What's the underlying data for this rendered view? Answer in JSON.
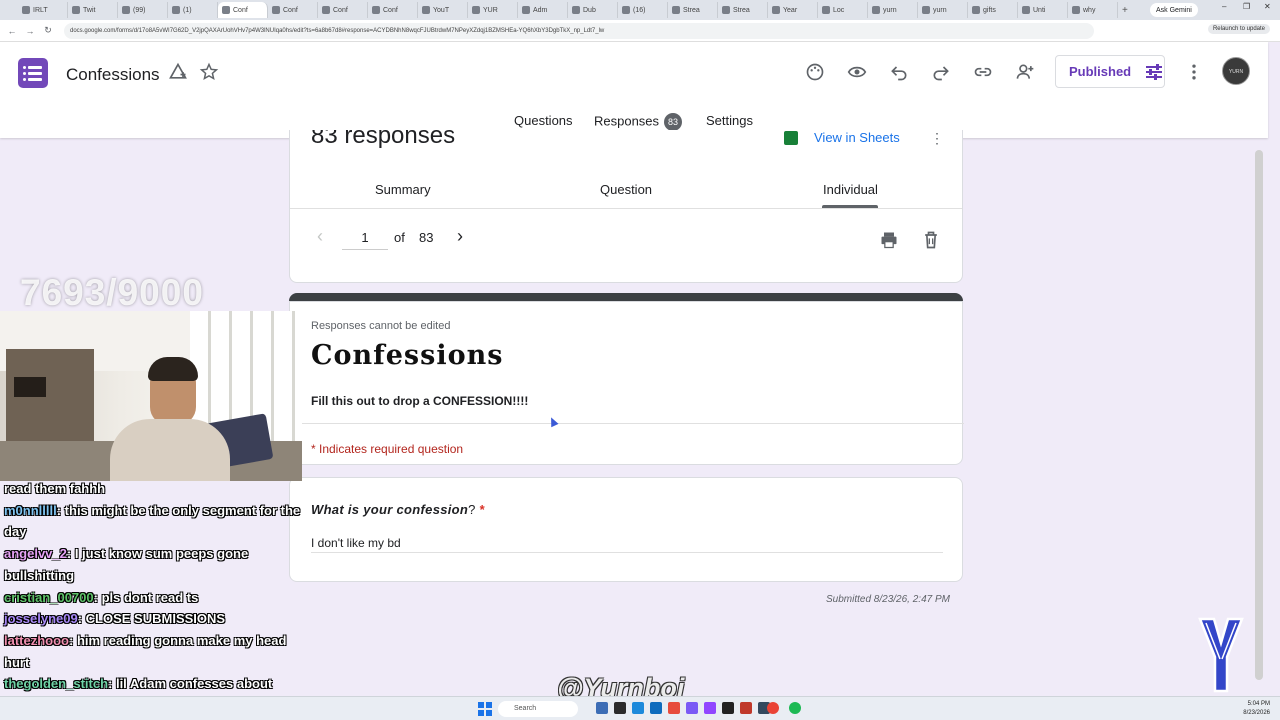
{
  "browser": {
    "tabs": [
      "IRLT",
      "Twit",
      "(99)",
      "(1)",
      "Conf",
      "Conf",
      "Conf",
      "Conf",
      "YouT",
      "YUR",
      "Adm",
      "Dub",
      "(16)",
      "Strea",
      "Strea",
      "Year",
      "Loc",
      "yurn",
      "yurn",
      "gifts",
      "Unti",
      "why"
    ],
    "new_tab": "+",
    "gemini": "Ask Gemini",
    "url": "docs.google.com/forms/d/17o8A5vWI7G62D_V2jpQAXArUohVHv7p4W3lNUIqa0hs/edit?ts=6a8b67d8#response=ACYDBNhN8wqcFJUBtrdwM7NPeyXZdqj1BZMSHEa-YQ6hXbY3DgbTkX_np_Ldt7_lw",
    "update": "Relaunch to update"
  },
  "header": {
    "title": "Confessions",
    "published_label": "Published",
    "avatar_text": "YURN",
    "tabs": {
      "questions": "Questions",
      "responses": "Responses",
      "responses_count": "83",
      "settings": "Settings"
    }
  },
  "responses": {
    "count_label": "83 responses",
    "view_sheets": "View in Sheets",
    "more": "⋮",
    "subtabs": {
      "summary": "Summary",
      "question": "Question",
      "individual": "Individual"
    },
    "pager": {
      "prev": "‹",
      "current": "1",
      "of": "of",
      "total": "83",
      "next": "›"
    }
  },
  "form": {
    "note": "Responses cannot be edited",
    "title": "Confessions",
    "description": "Fill this out to drop a CONFESSION!!!!",
    "required_note": "* Indicates required question",
    "question": "What is your confession",
    "question_suffix": "?",
    "required_star": "*",
    "answer": "I don't like my bd",
    "submitted": "Submitted 8/23/26, 2:47 PM"
  },
  "overlay": {
    "counter": "7693/9000",
    "chat": [
      {
        "user": "",
        "text": "read them fahhh"
      },
      {
        "user": "m0nnlllll",
        "color": "#7fc4f2",
        "text": ": this might be the only segment for the day"
      },
      {
        "user": "angelvv_2",
        "color": "#e6a2f5",
        "text": ": I just know sum peeps gone bullshitting"
      },
      {
        "user": "cristian_00700",
        "color": "#5fc46a",
        "text": ": pls dont read ts"
      },
      {
        "user": "josselyne09",
        "color": "#a889f7",
        "text": ": CLOSE SUBMISSIONS"
      },
      {
        "user": "lattezhooo",
        "color": "#f28fb1",
        "text": ": him reading gonna make my head hurt"
      },
      {
        "user": "thegolden_stitch",
        "color": "#6fd3a6",
        "text": ": lil Adam confesses about wetting the bed."
      }
    ],
    "watermark": "@Yurnboi"
  },
  "taskbar": {
    "search": "Search",
    "time": "5:04 PM",
    "date": "8/23/2026"
  },
  "colors": {
    "accent": "#673ab7",
    "link": "#1a73e8",
    "required": "#b3261e",
    "background": "#f0ebf8"
  }
}
